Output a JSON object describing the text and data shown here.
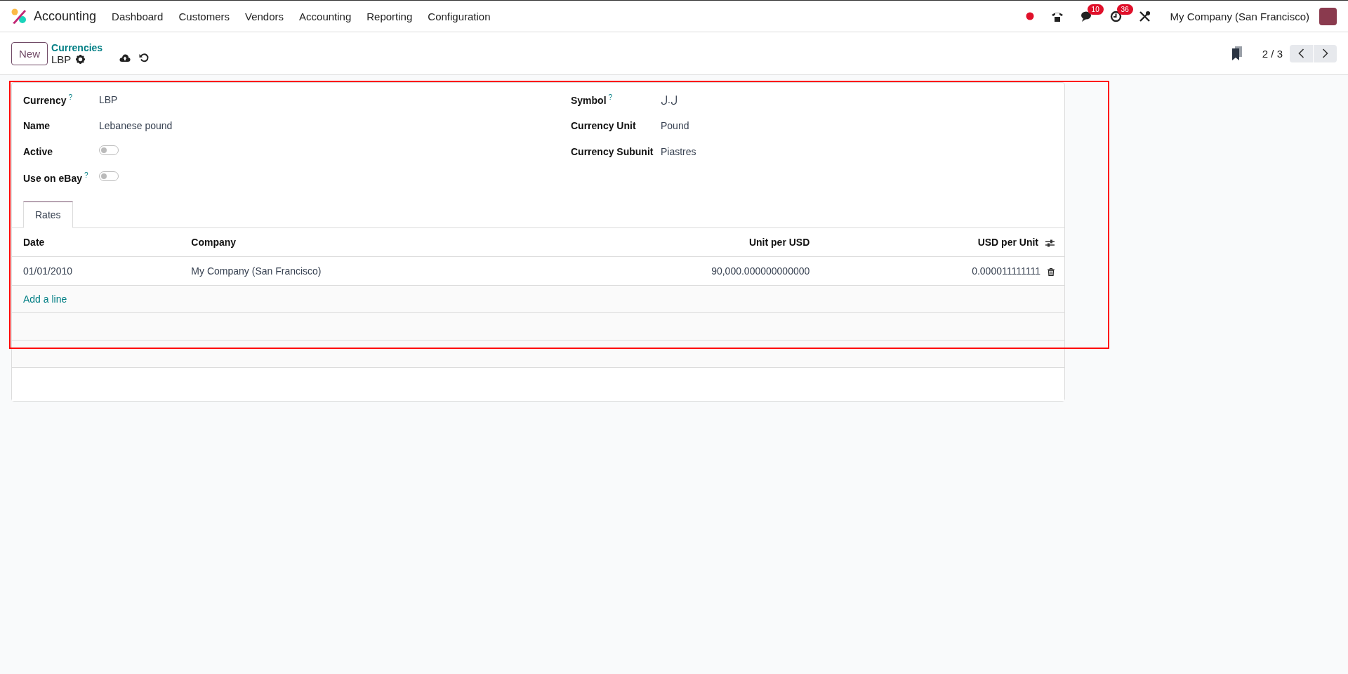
{
  "navbar": {
    "app_name": "Accounting",
    "menu": [
      "Dashboard",
      "Customers",
      "Vendors",
      "Accounting",
      "Reporting",
      "Configuration"
    ],
    "systray": [
      {
        "kind": "record"
      },
      {
        "kind": "phone"
      },
      {
        "kind": "chat",
        "count": "10"
      },
      {
        "kind": "activity",
        "count": "36"
      },
      {
        "kind": "tools"
      }
    ],
    "company": "My Company (San Francisco)"
  },
  "control_panel": {
    "new_button": "New",
    "breadcrumb": "Currencies",
    "record": "LBP",
    "pager": "2 / 3"
  },
  "form": {
    "left": [
      {
        "label": "Currency",
        "help": "?",
        "kind": "text",
        "value": "LBP"
      },
      {
        "label": "Name",
        "kind": "text",
        "value": "Lebanese pound"
      },
      {
        "label": "Active",
        "kind": "toggle",
        "on": false
      },
      {
        "label": "Use on eBay",
        "help": "?",
        "kind": "toggle",
        "on": false
      }
    ],
    "right": [
      {
        "label": "Symbol",
        "help": "?",
        "kind": "text",
        "value": "ل.ل"
      },
      {
        "label": "Currency Unit",
        "kind": "text",
        "value": "Pound"
      },
      {
        "label": "Currency Subunit",
        "kind": "text",
        "value": "Piastres"
      }
    ]
  },
  "tabs": [
    {
      "label": "Rates",
      "selected": true
    }
  ],
  "table": {
    "columns": [
      {
        "label": "Date",
        "kind": "text"
      },
      {
        "label": "Company",
        "kind": "text"
      },
      {
        "label": "Unit per USD",
        "kind": "number"
      },
      {
        "label": "USD per Unit",
        "kind": "number"
      }
    ],
    "rows": [
      [
        "01/01/2010",
        "My Company (San Francisco)",
        "90,000.000000000000",
        "0.000011111111"
      ]
    ],
    "add_line": "Add a line"
  }
}
